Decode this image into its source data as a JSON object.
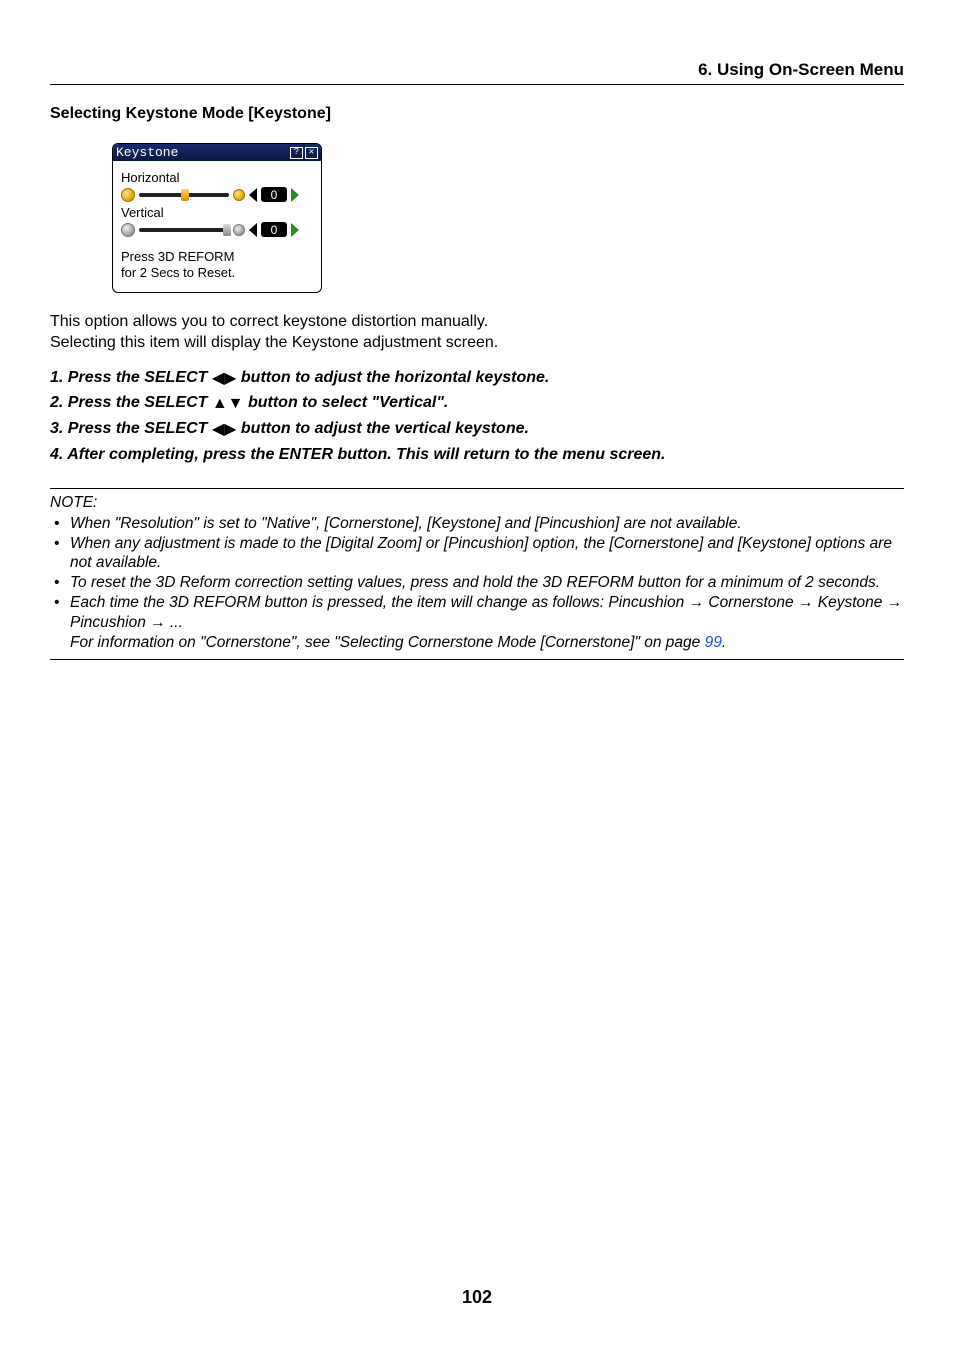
{
  "header": "6. Using On-Screen Menu",
  "section_title": "Selecting Keystone Mode [Keystone]",
  "shot": {
    "title": "Keystone",
    "h_label": "Horizontal",
    "h_value": "0",
    "v_label": "Vertical",
    "v_value": "0",
    "hint_l1": "Press 3D REFORM",
    "hint_l2": "for 2 Secs to Reset."
  },
  "body": {
    "l1": "This option allows you to correct keystone distortion manually.",
    "l2": "Selecting this item will display the Keystone adjustment screen."
  },
  "steps": {
    "s1a": "1.  Press the SELECT ",
    "s1b": " button to adjust the horizontal keystone.",
    "s2a": "2.  Press the SELECT ",
    "s2b": " button to select  \"Vertical\".",
    "s3a": "3.  Press the SELECT ",
    "s3b": " button to adjust the vertical keystone.",
    "s4": "4.  After completing, press the ENTER button. This will return to the menu screen."
  },
  "note": {
    "head": "NOTE:",
    "n1": "When \"Resolution\" is set to \"Native\", [Cornerstone], [Keystone] and [Pincushion] are not available.",
    "n2": "When any adjustment is made to the [Digital Zoom] or [Pincushion] option, the [Cornerstone] and [Keystone] options are not available.",
    "n3": "To reset the 3D Reform correction setting values, press and hold the 3D REFORM button for a minimum of 2 seconds.",
    "n4a": "Each time the 3D REFORM button is pressed, the item will change as follows: Pincushion ",
    "n4b": " Cornerstone ",
    "n4c": " Keystone ",
    "n4d": " Pincushion ",
    "n4e": " ...",
    "n4f": "For information on \"Cornerstone\", see \"Selecting Cornerstone Mode [Cornerstone]\" on page ",
    "link": "99",
    "n4g": "."
  },
  "page_number": "102"
}
